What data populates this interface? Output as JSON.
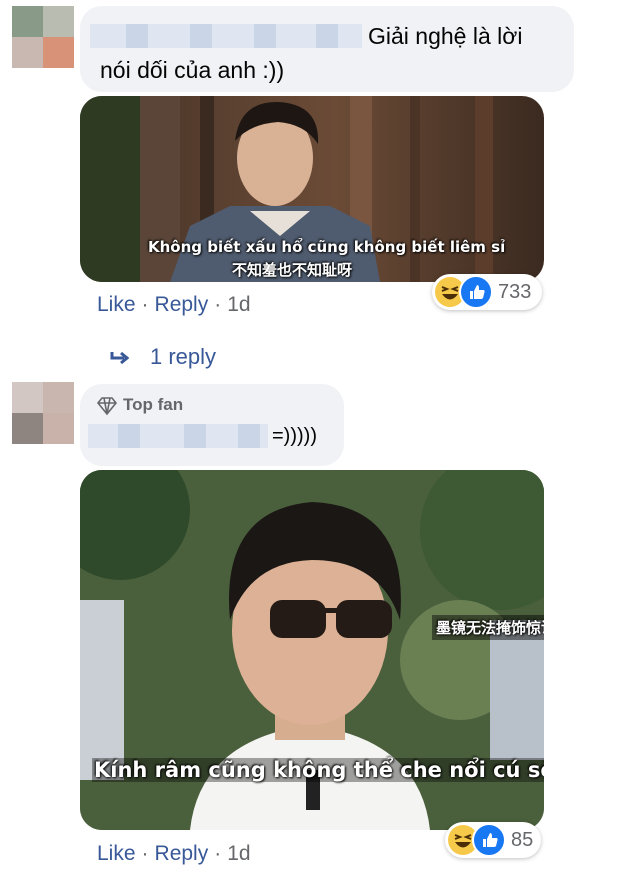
{
  "comments": [
    {
      "text_line1": "Giải nghệ là lời",
      "text_line2": "nói dối của anh :))",
      "image_subtitle_vi": "Không biết xấu hổ cũng không biết liêm sỉ",
      "image_subtitle_zh": "不知羞也不知耻呀",
      "actions": {
        "like": "Like",
        "separator": "·",
        "reply": "Reply",
        "time": "1d"
      },
      "reaction_count": "733",
      "replies_link": "1 reply"
    },
    {
      "badge": "Top fan",
      "text": "=)))))",
      "image_subtitle_vi": "Kính râm cũng không thể che nổi cú sốc này",
      "image_caption_zh": "墨镜无法掩饰惊讶",
      "actions": {
        "like": "Like",
        "separator": "·",
        "reply": "Reply",
        "time": "1d"
      },
      "reaction_count": "85"
    }
  ],
  "colors": {
    "bubble": "#f0f2f5",
    "link": "#385898",
    "meta": "#65676b",
    "like_blue": "#1877f2",
    "haha_yellow": "#f7c94b"
  },
  "icons": [
    "reply-arrow-icon",
    "diamond-icon",
    "haha-reaction-icon",
    "like-reaction-icon"
  ]
}
